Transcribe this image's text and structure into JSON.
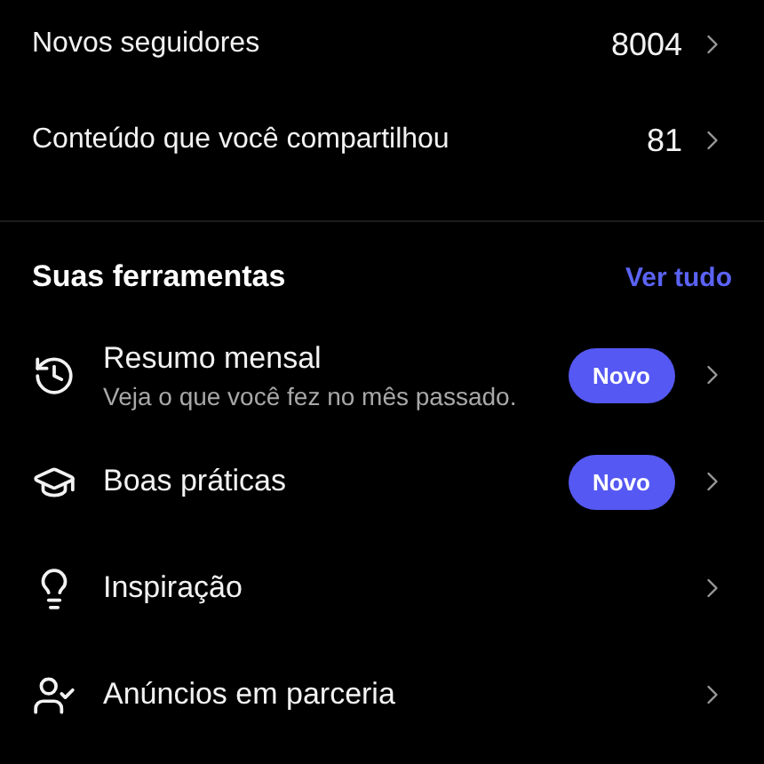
{
  "stats": [
    {
      "label": "Novos seguidores",
      "value": "8004"
    },
    {
      "label": "Conteúdo que você compartilhou",
      "value": "81"
    }
  ],
  "tools_header": {
    "title": "Suas ferramentas",
    "link": "Ver tudo"
  },
  "tools": [
    {
      "kind": "history",
      "title": "Resumo mensal",
      "subtitle": "Veja o que você fez no mês passado.",
      "badge": "Novo"
    },
    {
      "kind": "learn",
      "title": "Boas práticas",
      "badge": "Novo"
    },
    {
      "kind": "idea",
      "title": "Inspiração"
    },
    {
      "kind": "partner",
      "title": "Anúncios em parceria"
    }
  ]
}
